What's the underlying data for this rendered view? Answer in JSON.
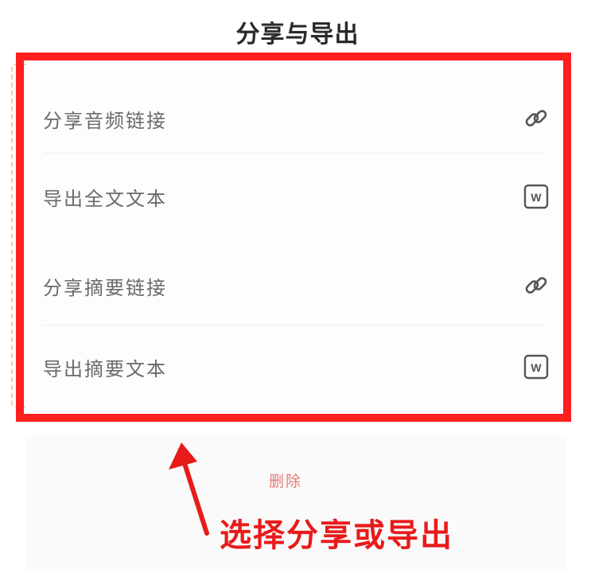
{
  "header": {
    "title": "分享与导出"
  },
  "menu": {
    "items": [
      {
        "label": "分享音频链接",
        "icon": "link-icon"
      },
      {
        "label": "导出全文文本",
        "icon": "word-doc-icon"
      },
      {
        "label": "分享摘要链接",
        "icon": "link-icon"
      },
      {
        "label": "导出摘要文本",
        "icon": "word-doc-icon"
      }
    ]
  },
  "actions": {
    "delete_label": "删除"
  },
  "annotation": {
    "text": "选择分享或导出",
    "color": "#e81b1b"
  },
  "colors": {
    "highlight": "#ff1f1f",
    "delete": "#e97a74"
  }
}
